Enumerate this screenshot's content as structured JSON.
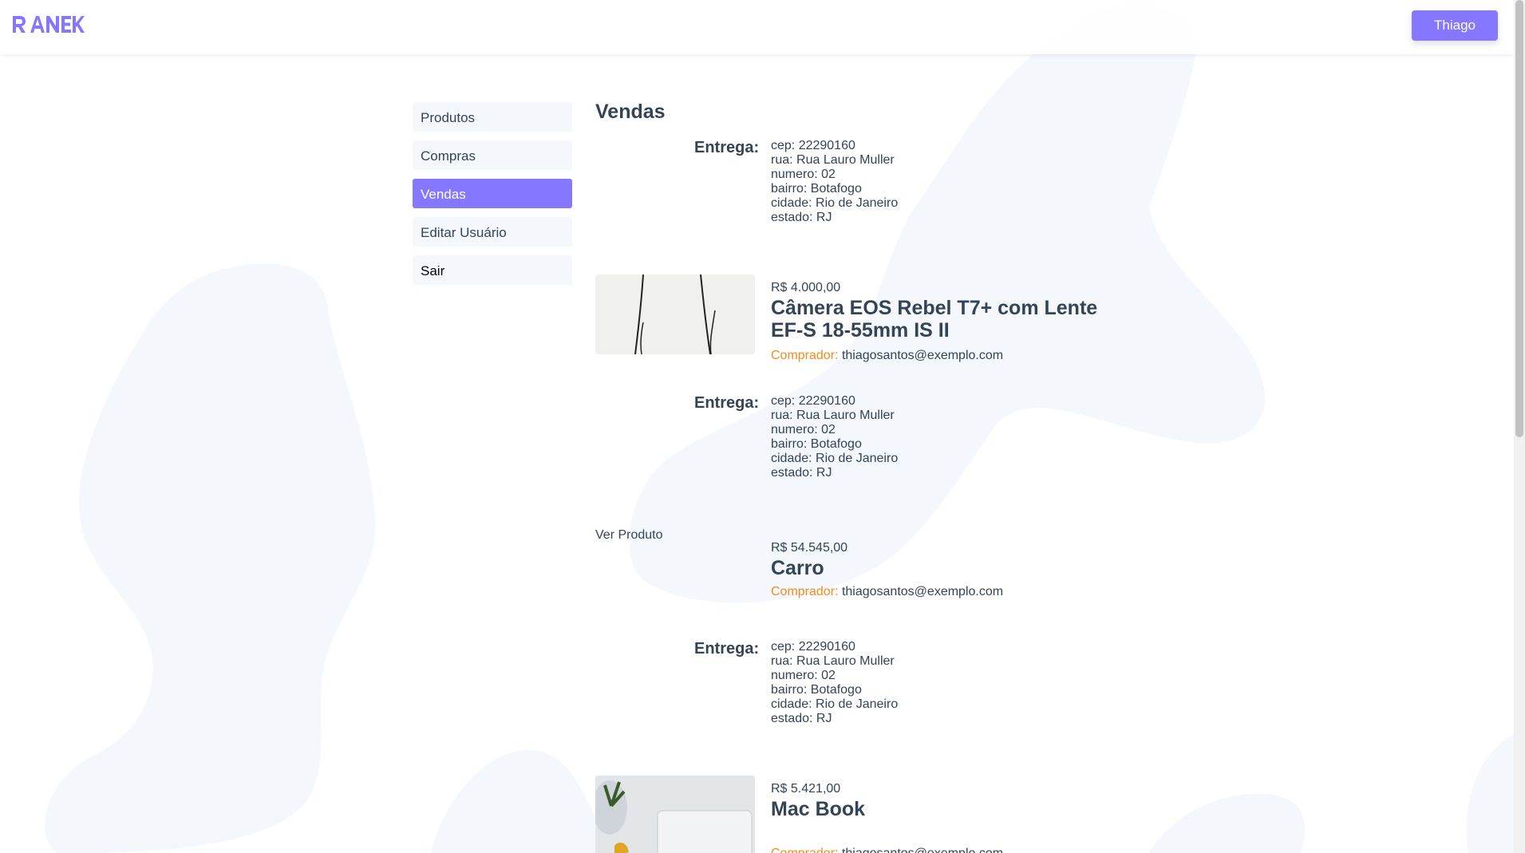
{
  "header": {
    "logo_text": "RANEK",
    "user_button_label": "Thiago"
  },
  "sidebar": {
    "items": [
      {
        "label": "Produtos"
      },
      {
        "label": "Compras"
      },
      {
        "label": "Vendas"
      },
      {
        "label": "Editar Usuário"
      },
      {
        "label": "Sair"
      }
    ],
    "active": "Vendas"
  },
  "main": {
    "title": "Vendas",
    "delivery_label": "Entrega:",
    "buyer_label": "Comprador:",
    "deliveries": [
      {
        "cep": "cep: 22290160",
        "rua": "rua: Rua Lauro Muller",
        "numero": "numero: 02",
        "bairro": "bairro: Botafogo",
        "cidade": "cidade: Rio de Janeiro",
        "estado": "estado: RJ"
      },
      {
        "cep": "cep: 22290160",
        "rua": "rua: Rua Lauro Muller",
        "numero": "numero: 02",
        "bairro": "bairro: Botafogo",
        "cidade": "cidade: Rio de Janeiro",
        "estado": "estado: RJ"
      },
      {
        "cep": "cep: 22290160",
        "rua": "rua: Rua Lauro Muller",
        "numero": "numero: 02",
        "bairro": "bairro: Botafogo",
        "cidade": "cidade: Rio de Janeiro",
        "estado": "estado: RJ"
      }
    ],
    "sales": [
      {
        "price": "R$ 4.000,00",
        "title": "Câmera EOS Rebel T7+ com Lente EF-S 18-55mm IS II",
        "buyer": "thiagosantos@exemplo.com"
      },
      {
        "view_link": "Ver Produto",
        "price": "R$ 54.545,00",
        "title": "Carro",
        "buyer": "thiagosantos@exemplo.com"
      },
      {
        "price": "R$ 5.421,00",
        "title": "Mac Book",
        "buyer": "thiagosantos@exemplo.com"
      }
    ]
  },
  "colors": {
    "accent": "#8577ff",
    "buyer_label": "#f58b1c",
    "text": "#334455",
    "nav_bg": "#f4f7fc",
    "blob": "#f4f7fc"
  }
}
